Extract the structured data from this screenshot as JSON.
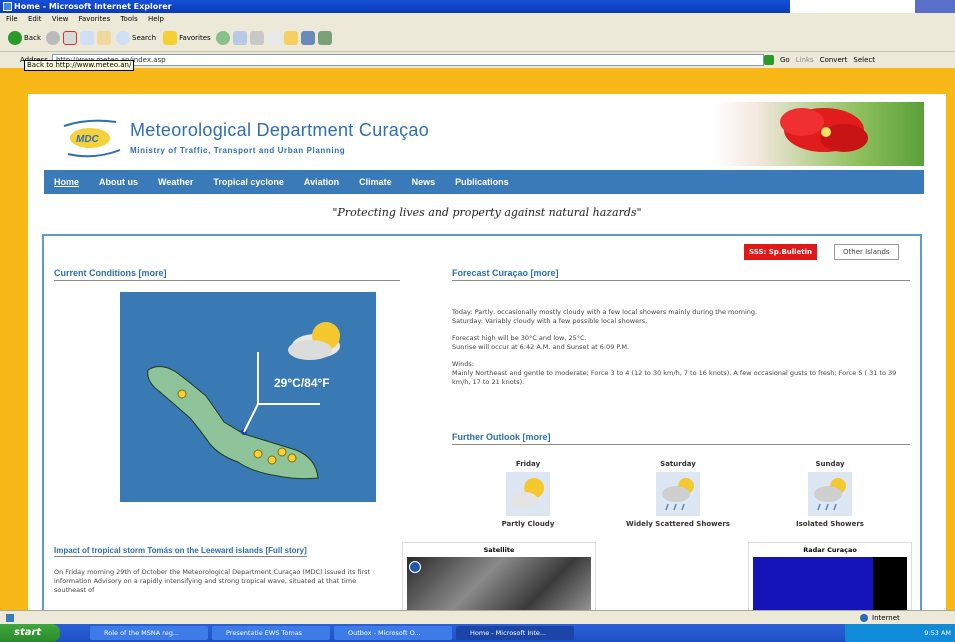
{
  "window": {
    "title": "Home - Microsoft Internet Explorer"
  },
  "menu": [
    "File",
    "Edit",
    "View",
    "Favorites",
    "Tools",
    "Help"
  ],
  "toolbar": {
    "back": "Back",
    "search": "Search",
    "favorites": "Favorites"
  },
  "address": {
    "label": "Address",
    "url": "http://www.meteo.an/index.asp",
    "go": "Go",
    "links": "Links",
    "convert": "Convert",
    "select": "Select"
  },
  "tooltip": "Back to http://www.meteo.an/",
  "site": {
    "logo_text": "MDC",
    "title": "Meteorological Department Curaçao",
    "subtitle": "Ministry of Traffic, Transport and Urban Planning",
    "nav": [
      "Home",
      "About us",
      "Weather",
      "Tropical cyclone",
      "Aviation",
      "Climate",
      "News",
      "Publications"
    ],
    "slogan": "\"Protecting lives and property against natural hazards\""
  },
  "buttons": {
    "sss": "SSS: Sp.Bulletin",
    "other": "Other Islands"
  },
  "current": {
    "heading": "Current Conditions [more]",
    "temperature": "29°C/84°F"
  },
  "forecast": {
    "heading": "Forecast Curaçao [more]",
    "today": "Today: Partly, occasionally mostly cloudy with a few local showers mainly during the morning.",
    "saturday": "Saturday: Variably cloudy with a few possible local showers.",
    "high_low": "Forecast high will be 30°C and low, 25°C.",
    "sun": "Sunrise will occur at 6:42 A.M. and Sunset at 6:09 P.M.",
    "winds_label": "Winds:",
    "winds": "Mainly Northeast and gentle to moderate; Force 3 to 4 (12 to 30 km/h, 7 to 16 knots). A few occasional gusts to fresh; Force 5 ( 31 to 39 km/h, 17 to 21 knots)."
  },
  "outlook": {
    "heading": "Further Outlook [more]",
    "days": [
      {
        "day": "Friday",
        "desc": "Partly Cloudy",
        "icon": "partly-cloudy-icon"
      },
      {
        "day": "Saturday",
        "desc": "Widely Scattered Showers",
        "icon": "showers-icon"
      },
      {
        "day": "Sunday",
        "desc": "Isolated Showers",
        "icon": "showers-icon"
      }
    ]
  },
  "story": {
    "heading": "Impact of tropical storm Tomás on the Leeward islands [Full story]",
    "text": "On Friday morning 29th of October the Meteorological Department Curaçao (MDC) issued its first information Advisory on a rapidly intensifying and strong tropical wave, situated at that time southeast of"
  },
  "panels": {
    "satellite": "Satellite",
    "radar": "Radar Curaçao"
  },
  "status": {
    "zone": "Internet"
  },
  "taskbar": {
    "start": "start",
    "tasks": [
      "Role of the MSNA reg...",
      "Presentatie EWS Tomas",
      "Outbox - Microsoft O...",
      "Home - Microsoft Inte..."
    ],
    "clock": "9:53 AM"
  },
  "colors": {
    "nav": "#3b7ab8",
    "frame": "#f8b818",
    "accent": "#2f6fb0",
    "sss": "#e01818"
  }
}
